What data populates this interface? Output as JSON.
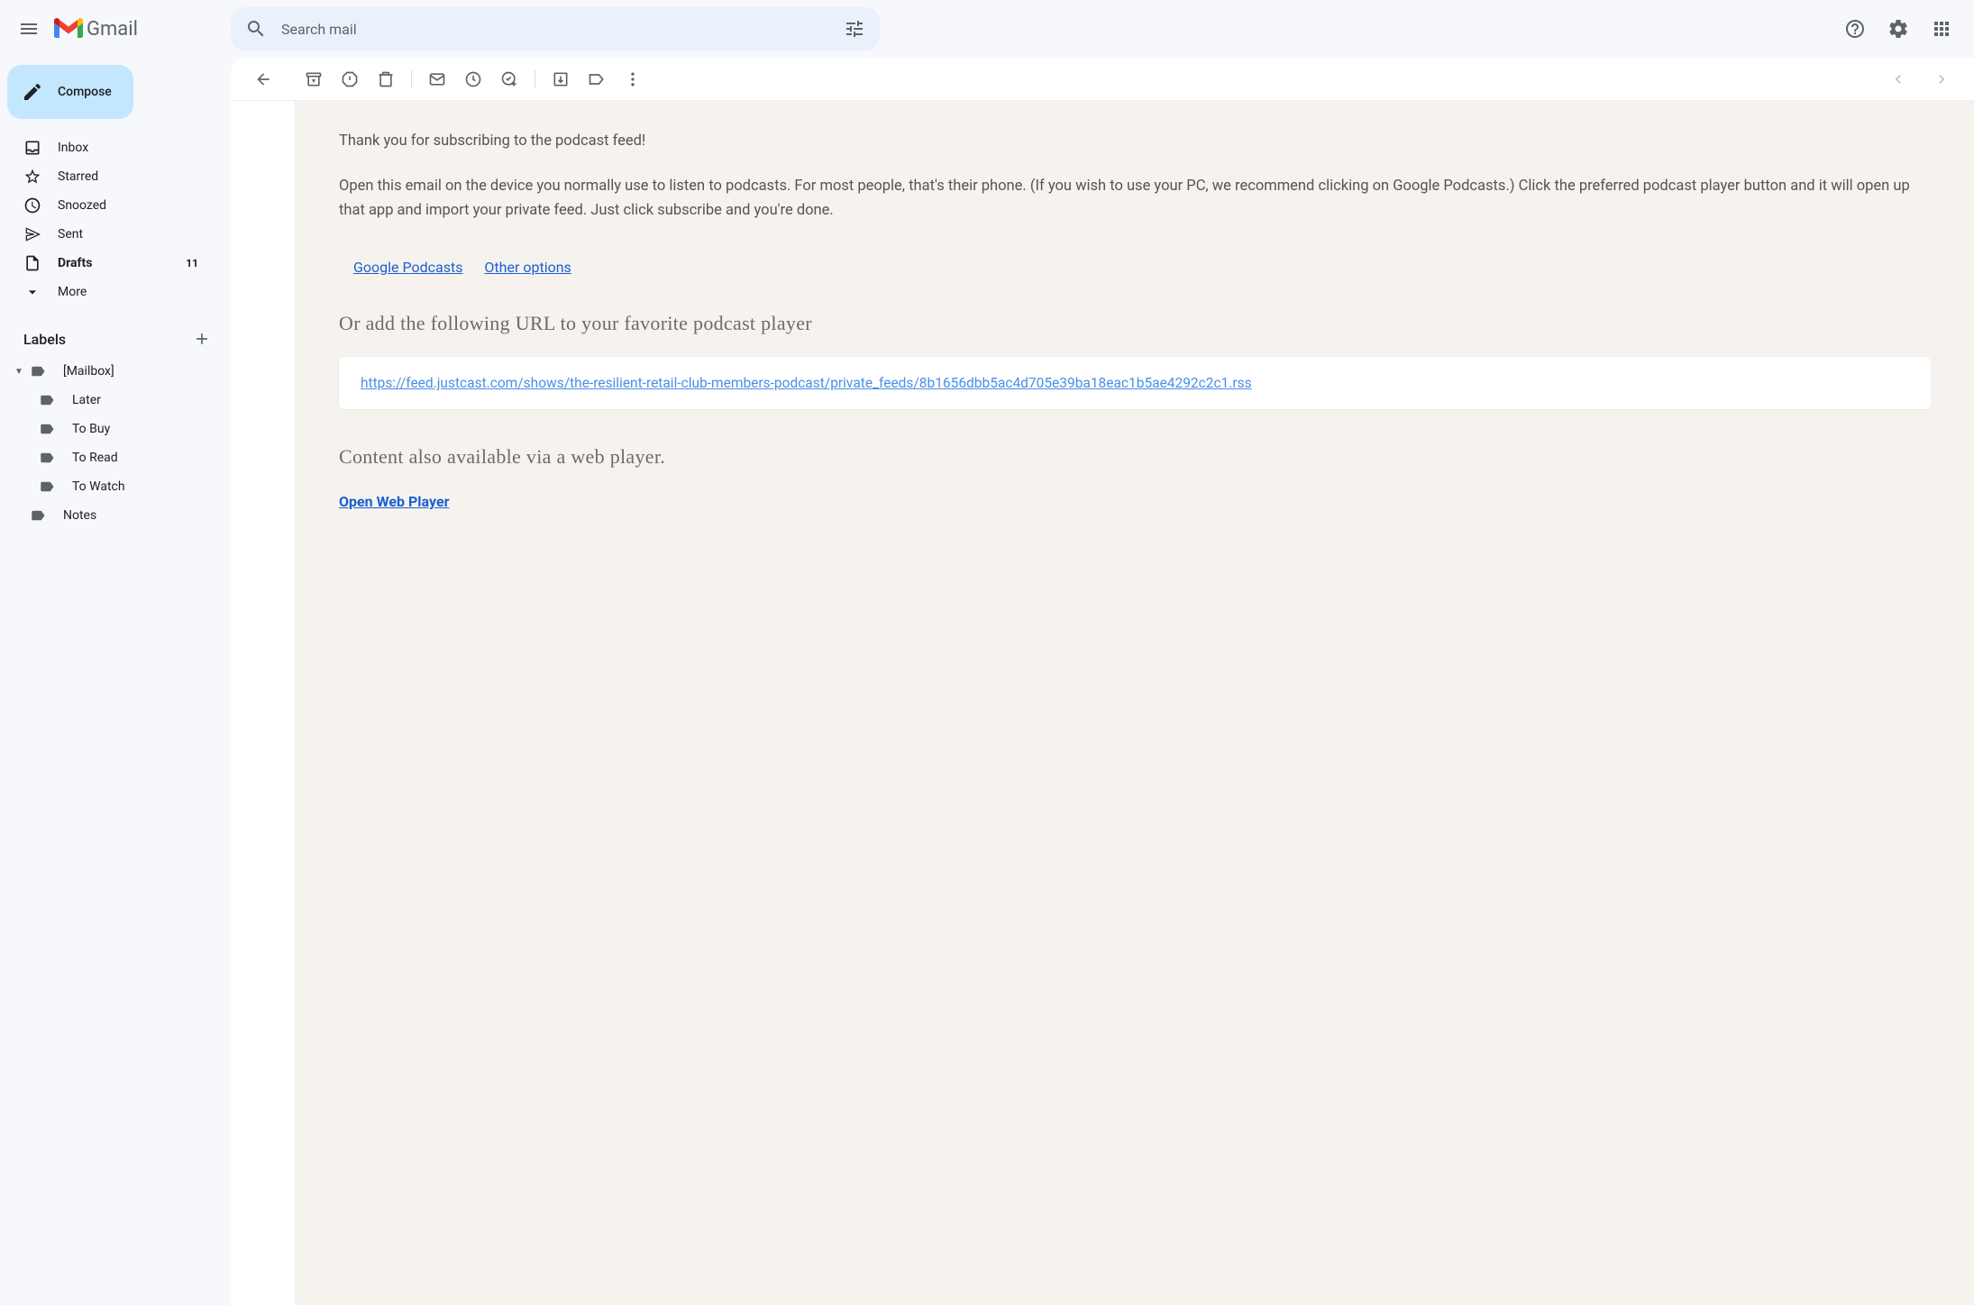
{
  "header": {
    "logo_text": "Gmail",
    "search_placeholder": "Search mail"
  },
  "sidebar": {
    "compose": "Compose",
    "folders": [
      {
        "label": "Inbox",
        "icon": "inbox",
        "bold": false,
        "count": ""
      },
      {
        "label": "Starred",
        "icon": "star",
        "bold": false,
        "count": ""
      },
      {
        "label": "Snoozed",
        "icon": "clock",
        "bold": false,
        "count": ""
      },
      {
        "label": "Sent",
        "icon": "send",
        "bold": false,
        "count": ""
      },
      {
        "label": "Drafts",
        "icon": "file",
        "bold": true,
        "count": "11"
      },
      {
        "label": "More",
        "icon": "chevron-down",
        "bold": false,
        "count": ""
      }
    ],
    "labels_title": "Labels",
    "labels": [
      {
        "label": "[Mailbox]",
        "sub": false,
        "expandable": true
      },
      {
        "label": "Later",
        "sub": true,
        "expandable": false
      },
      {
        "label": "To Buy",
        "sub": true,
        "expandable": false
      },
      {
        "label": "To Read",
        "sub": true,
        "expandable": false
      },
      {
        "label": "To Watch",
        "sub": true,
        "expandable": false
      },
      {
        "label": "Notes",
        "sub": false,
        "expandable": false
      }
    ]
  },
  "email": {
    "p1": "Thank you for subscribing to the podcast feed!",
    "p2": "Open this email on the device you normally use to listen to podcasts. For most people, that's their phone. (If you wish to use your PC, we recommend clicking on Google Podcasts.) Click the preferred podcast player button and it will open up that app and import your private feed. Just click subscribe and you're done.",
    "link1": "Google Podcasts",
    "link2": "Other options",
    "h1": "Or add the following URL to your favorite podcast player",
    "feed_url": "https://feed.justcast.com/shows/the-resilient-retail-club-members-podcast/private_feeds/8b1656dbb5ac4d705e39ba18eac1b5ae4292c2c1.rss",
    "h2": "Content also available via a web player.",
    "webplayer": "Open Web Player"
  }
}
